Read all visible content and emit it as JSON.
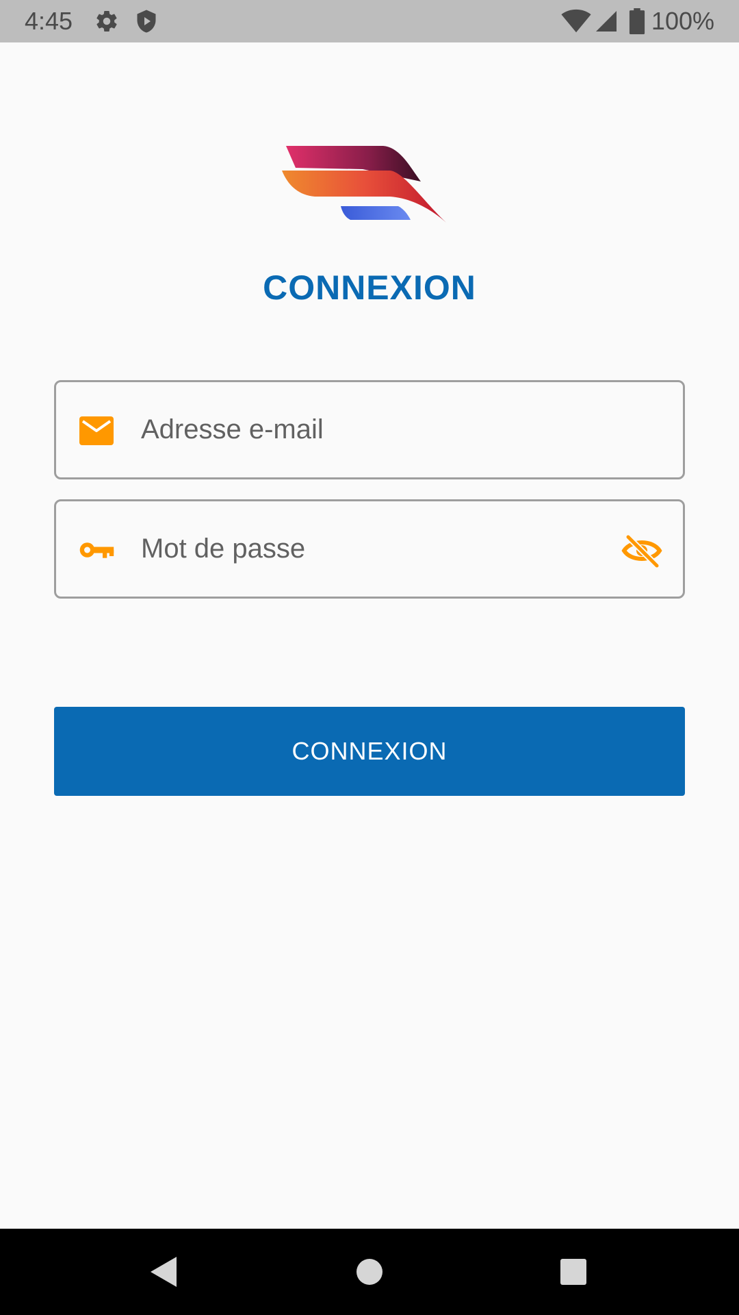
{
  "status_bar": {
    "time": "4:45",
    "battery": "100%",
    "icons": [
      "gear-icon",
      "shield-icon",
      "wifi-icon",
      "signal-icon",
      "battery-icon"
    ]
  },
  "logo": {
    "name": "brand-logo"
  },
  "title": "CONNEXION",
  "email_field": {
    "placeholder": "Adresse e-mail",
    "value": "",
    "icon": "mail-icon"
  },
  "password_field": {
    "placeholder": "Mot de passe",
    "value": "",
    "icon": "key-icon",
    "toggle_icon": "eye-off-icon"
  },
  "login_button": {
    "label": "CONNEXION"
  },
  "nav_bar": {
    "icons": [
      "back-icon",
      "home-icon",
      "recents-icon"
    ]
  },
  "colors": {
    "primary": "#0a6ab3",
    "accent": "#ff9800",
    "background": "#fafafa",
    "status_bar": "#bdbdbd",
    "nav_bar": "#000000"
  }
}
